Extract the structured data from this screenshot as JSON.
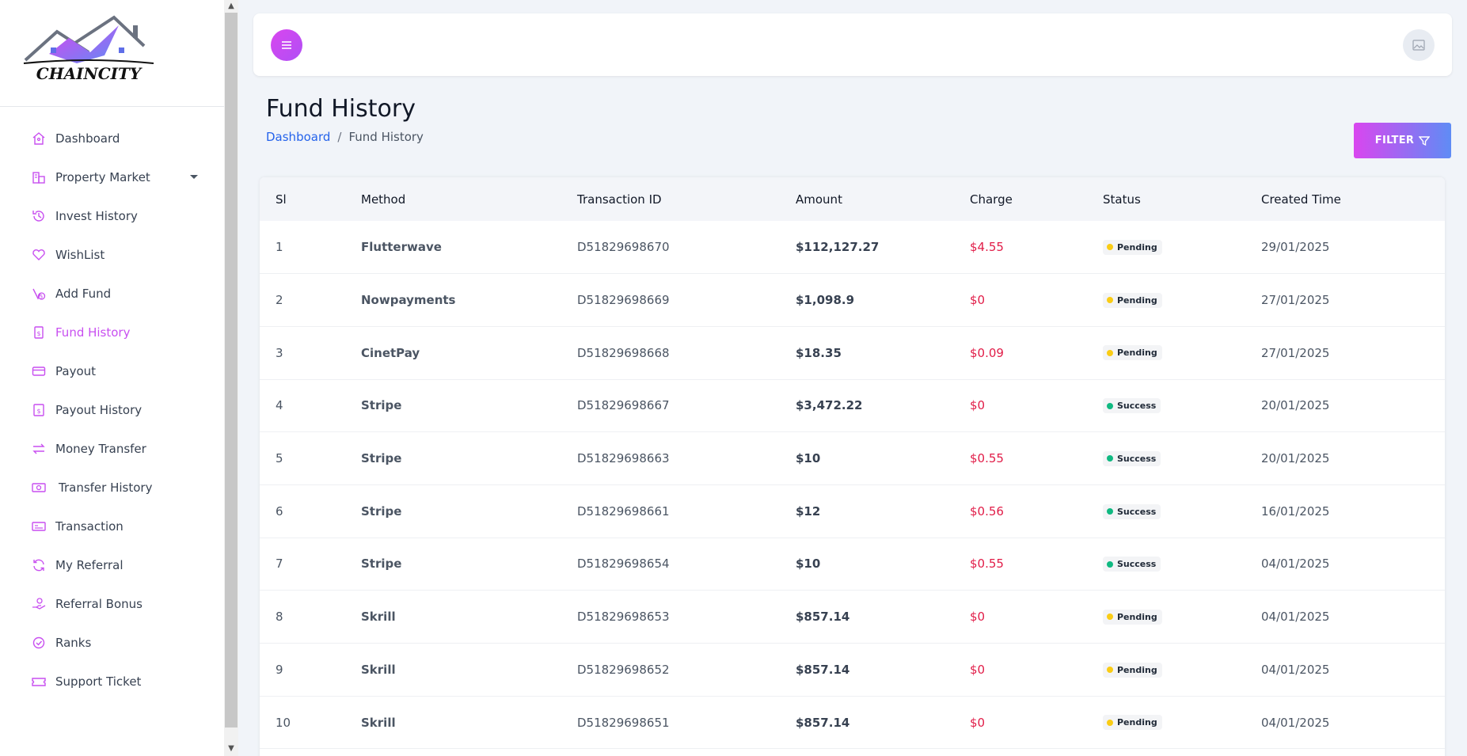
{
  "brand": {
    "name": "CHAINCITY"
  },
  "sidebar": {
    "items": [
      {
        "label": "Dashboard",
        "icon": "home-icon",
        "active": false
      },
      {
        "label": "Property Market",
        "icon": "property-icon",
        "active": false,
        "has_submenu": true
      },
      {
        "label": "Invest History",
        "icon": "history-icon",
        "active": false
      },
      {
        "label": "WishList",
        "icon": "heart-icon",
        "active": false
      },
      {
        "label": "Add Fund",
        "icon": "add-fund-icon",
        "active": false
      },
      {
        "label": "Fund History",
        "icon": "fund-history-icon",
        "active": true
      },
      {
        "label": "Payout",
        "icon": "credit-card-icon",
        "active": false
      },
      {
        "label": "Payout History",
        "icon": "dollar-doc-icon",
        "active": false
      },
      {
        "label": "Money Transfer",
        "icon": "transfer-icon",
        "active": false
      },
      {
        "label": "Transfer History",
        "icon": "cash-icon",
        "active": false
      },
      {
        "label": "Transaction",
        "icon": "receipt-icon",
        "active": false
      },
      {
        "label": "My Referral",
        "icon": "refresh-icon",
        "active": false
      },
      {
        "label": "Referral Bonus",
        "icon": "hand-coin-icon",
        "active": false
      },
      {
        "label": "Ranks",
        "icon": "badge-check-icon",
        "active": false
      },
      {
        "label": "Support Ticket",
        "icon": "ticket-icon",
        "active": false
      }
    ]
  },
  "header": {
    "page_title": "Fund History"
  },
  "breadcrumb": {
    "home": "Dashboard",
    "separator": "/",
    "current": "Fund History"
  },
  "filter": {
    "label": "FILTER"
  },
  "colors": {
    "accent": "#c84ff0",
    "link": "#2563eb",
    "charge": "#e11d48",
    "pending": "#facc15",
    "success": "#10b981"
  },
  "table": {
    "columns": [
      "Sl",
      "Method",
      "Transaction ID",
      "Amount",
      "Charge",
      "Status",
      "Created Time"
    ],
    "rows": [
      {
        "sl": "1",
        "method": "Flutterwave",
        "txn": "D51829698670",
        "amount": "$112,127.27",
        "charge": "$4.55",
        "status": "Pending",
        "time": "29/01/2025"
      },
      {
        "sl": "2",
        "method": "Nowpayments",
        "txn": "D51829698669",
        "amount": "$1,098.9",
        "charge": "$0",
        "status": "Pending",
        "time": "27/01/2025"
      },
      {
        "sl": "3",
        "method": "CinetPay",
        "txn": "D51829698668",
        "amount": "$18.35",
        "charge": "$0.09",
        "status": "Pending",
        "time": "27/01/2025"
      },
      {
        "sl": "4",
        "method": "Stripe",
        "txn": "D51829698667",
        "amount": "$3,472.22",
        "charge": "$0",
        "status": "Success",
        "time": "20/01/2025"
      },
      {
        "sl": "5",
        "method": "Stripe",
        "txn": "D51829698663",
        "amount": "$10",
        "charge": "$0.55",
        "status": "Success",
        "time": "20/01/2025"
      },
      {
        "sl": "6",
        "method": "Stripe",
        "txn": "D51829698661",
        "amount": "$12",
        "charge": "$0.56",
        "status": "Success",
        "time": "16/01/2025"
      },
      {
        "sl": "7",
        "method": "Stripe",
        "txn": "D51829698654",
        "amount": "$10",
        "charge": "$0.55",
        "status": "Success",
        "time": "04/01/2025"
      },
      {
        "sl": "8",
        "method": "Skrill",
        "txn": "D51829698653",
        "amount": "$857.14",
        "charge": "$0",
        "status": "Pending",
        "time": "04/01/2025"
      },
      {
        "sl": "9",
        "method": "Skrill",
        "txn": "D51829698652",
        "amount": "$857.14",
        "charge": "$0",
        "status": "Pending",
        "time": "04/01/2025"
      },
      {
        "sl": "10",
        "method": "Skrill",
        "txn": "D51829698651",
        "amount": "$857.14",
        "charge": "$0",
        "status": "Pending",
        "time": "04/01/2025"
      }
    ]
  }
}
